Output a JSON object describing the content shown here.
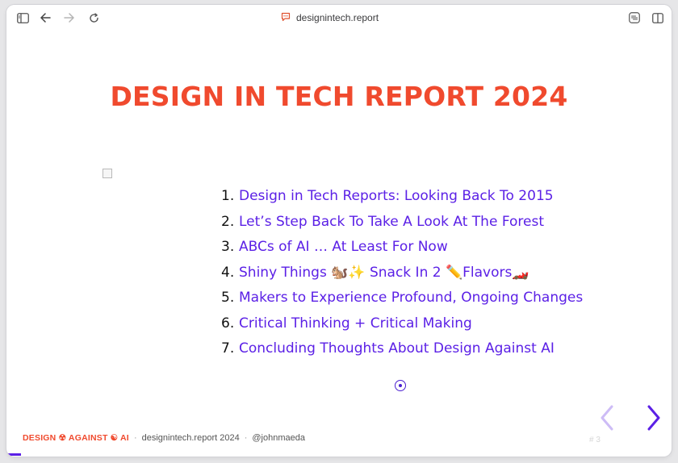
{
  "browser": {
    "url": "designintech.report"
  },
  "slide": {
    "title": "DESIGN IN TECH REPORT 2024",
    "agenda": [
      {
        "number": "1.",
        "label": "Design in Tech Reports: Looking Back To 2015"
      },
      {
        "number": "2.",
        "label": "Let’s Step Back To Take A Look At The Forest"
      },
      {
        "number": "3.",
        "label": "ABCs of AI … At Least For Now"
      },
      {
        "number": "4.",
        "label": "Shiny Things 🐿️✨ Snack In 2 ✏️Flavors🏎️"
      },
      {
        "number": "5.",
        "label": "Makers to Experience Profound, Ongoing Changes"
      },
      {
        "number": "6.",
        "label": "Critical Thinking + Critical Making"
      },
      {
        "number": "7.",
        "label": "Concluding Thoughts About Design Against AI"
      }
    ],
    "page_number": "# 3",
    "progress_fraction": 0.02
  },
  "footer": {
    "brand": "DESIGN ☢ AGAINST ☯ AI",
    "separator": "·",
    "site": "designintech.report 2024",
    "handle": "@johnmaeda"
  },
  "colors": {
    "accent": "#f04a2e",
    "link": "#5b20e6"
  }
}
